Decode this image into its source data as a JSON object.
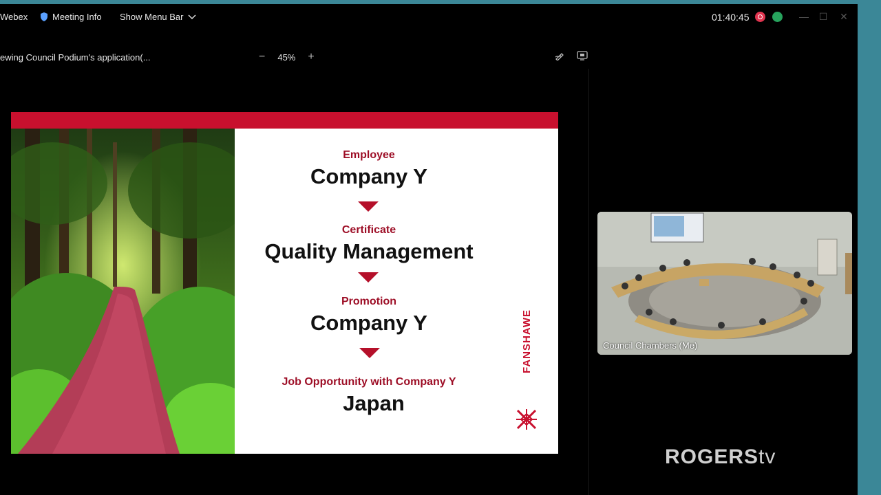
{
  "titlebar": {
    "app_name": "Webex",
    "meeting_info": "Meeting Info",
    "show_menu_bar": "Show Menu Bar",
    "timer": "01:40:45",
    "colors": {
      "record": "#e0344f",
      "stats": "#27a35d"
    }
  },
  "sharebar": {
    "title": "ewing Council Podium's application(...",
    "zoom_level": "45%",
    "zoom_out": "−",
    "zoom_in": "+"
  },
  "slide": {
    "label1": "Employee",
    "value1": "Company Y",
    "label2": "Certificate",
    "value2": "Quality Management",
    "label3": "Promotion",
    "value3": "Company Y",
    "label4": "Job Opportunity with Company Y",
    "value4": "Japan",
    "brand": "FANSHAWE",
    "accent_color": "#c8102e"
  },
  "video": {
    "label": "Council Chambers (Me)"
  },
  "watermark": {
    "brand_main": "ROGERS",
    "brand_suffix": "tv"
  }
}
